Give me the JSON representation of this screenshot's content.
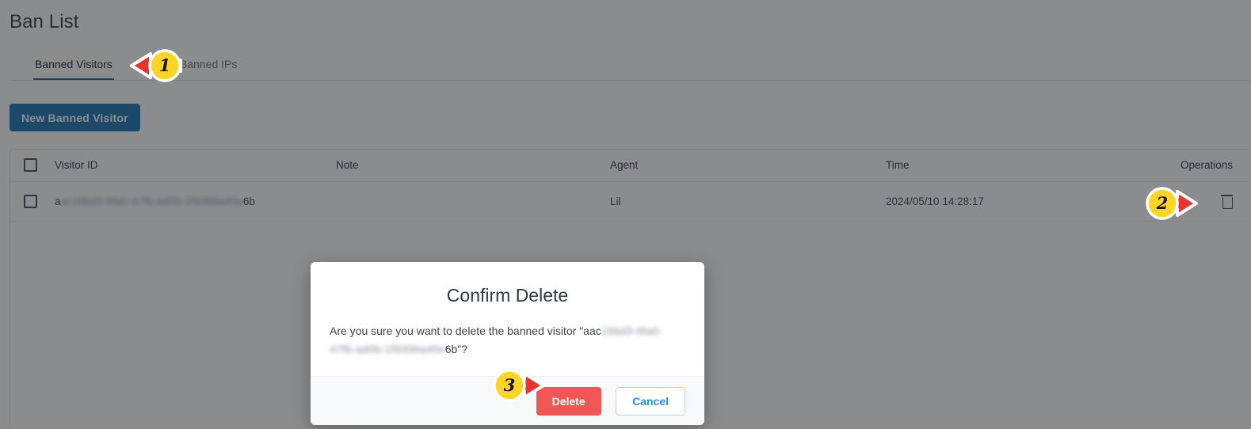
{
  "page": {
    "title": "Ban List"
  },
  "tabs": [
    {
      "label": "Banned Visitors",
      "active": true
    },
    {
      "label": "Banned IPs",
      "active": false
    }
  ],
  "toolbar": {
    "new_banned_visitor_label": "New Banned Visitor"
  },
  "table": {
    "columns": [
      "Visitor ID",
      "Note",
      "Agent",
      "Time",
      "Operations"
    ],
    "rows": [
      {
        "visitor_id_prefix": "a",
        "visitor_id_redacted": "ac16bd3-6fa0-47fb-ad0b-1f9396a45e",
        "visitor_id_suffix": "6b",
        "note": "",
        "agent": "Lil",
        "time": "2024/05/10 14:28:17",
        "operation_icon": "trash-icon"
      }
    ]
  },
  "dialog": {
    "title": "Confirm Delete",
    "message_prefix": "Are you sure you want to delete the banned visitor \"aac",
    "message_redacted": "16bd3-6fa0-47fb-ad0b-1f9396a45e",
    "message_suffix": "6b\"?",
    "delete_label": "Delete",
    "cancel_label": "Cancel"
  },
  "annotations": [
    {
      "number": "1",
      "direction": "left",
      "target": "tab-banned-visitors"
    },
    {
      "number": "2",
      "direction": "right",
      "target": "row-delete-icon"
    },
    {
      "number": "3",
      "direction": "right",
      "target": "dialog-delete-button"
    }
  ],
  "colors": {
    "primary": "#1570b0",
    "danger": "#f05654",
    "link": "#2d8cf0",
    "tab_active_underline": "#1d5b86",
    "marker_arrow": "#e8342f",
    "marker_badge": "#ffd429"
  }
}
